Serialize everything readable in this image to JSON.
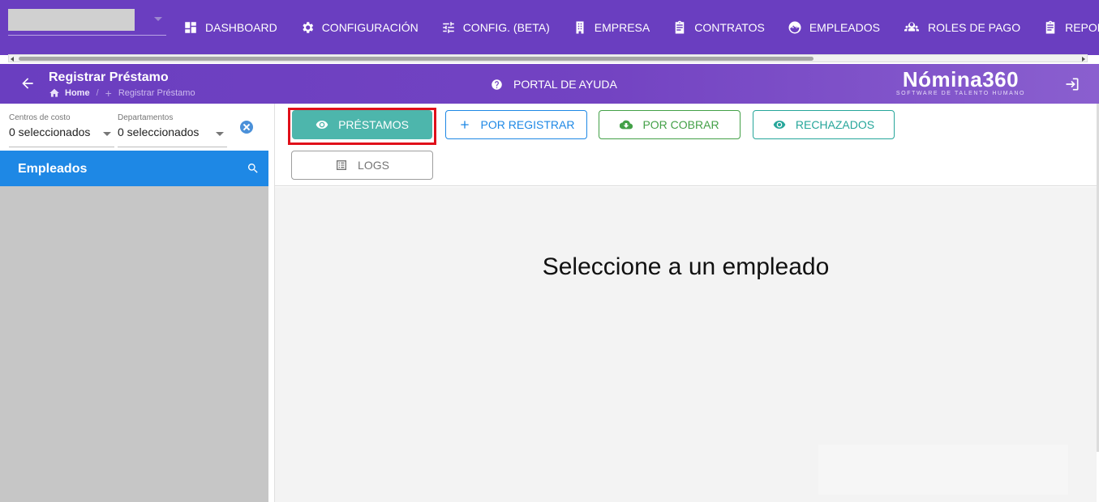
{
  "topnav": {
    "items": [
      {
        "label": "DASHBOARD",
        "icon": "dashboard-icon"
      },
      {
        "label": "CONFIGURACIÓN",
        "icon": "gear-icon"
      },
      {
        "label": "CONFIG. (BETA)",
        "icon": "tune-icon"
      },
      {
        "label": "EMPRESA",
        "icon": "building-icon"
      },
      {
        "label": "CONTRATOS",
        "icon": "clipboard-icon"
      },
      {
        "label": "EMPLEADOS",
        "icon": "face-icon"
      },
      {
        "label": "ROLES DE PAGO",
        "icon": "group-icon"
      },
      {
        "label": "REPORTES",
        "icon": "report-icon"
      }
    ],
    "color": "#6a3ec0"
  },
  "page": {
    "title": "Registrar Préstamo",
    "breadcrumb_home": "Home",
    "breadcrumb_sep": "/",
    "breadcrumb_current": "Registrar Préstamo",
    "help_label": "PORTAL DE AYUDA",
    "logo_main": "Nómina360",
    "logo_sub": "SOFTWARE DE TALENTO HUMANO"
  },
  "filters": {
    "cost_centers_label": "Centros de costo",
    "cost_centers_value": "0 seleccionados",
    "departments_label": "Departamentos",
    "departments_value": "0 seleccionados"
  },
  "employees": {
    "title": "Empleados",
    "header_color": "#1e88e5"
  },
  "actions": {
    "prestamos": "PRÉSTAMOS",
    "por_registrar": "POR REGISTRAR",
    "por_cobrar": "POR COBRAR",
    "rechazados": "RECHAZADOS",
    "logs": "LOGS"
  },
  "main": {
    "empty_message": "Seleccione a un empleado"
  }
}
